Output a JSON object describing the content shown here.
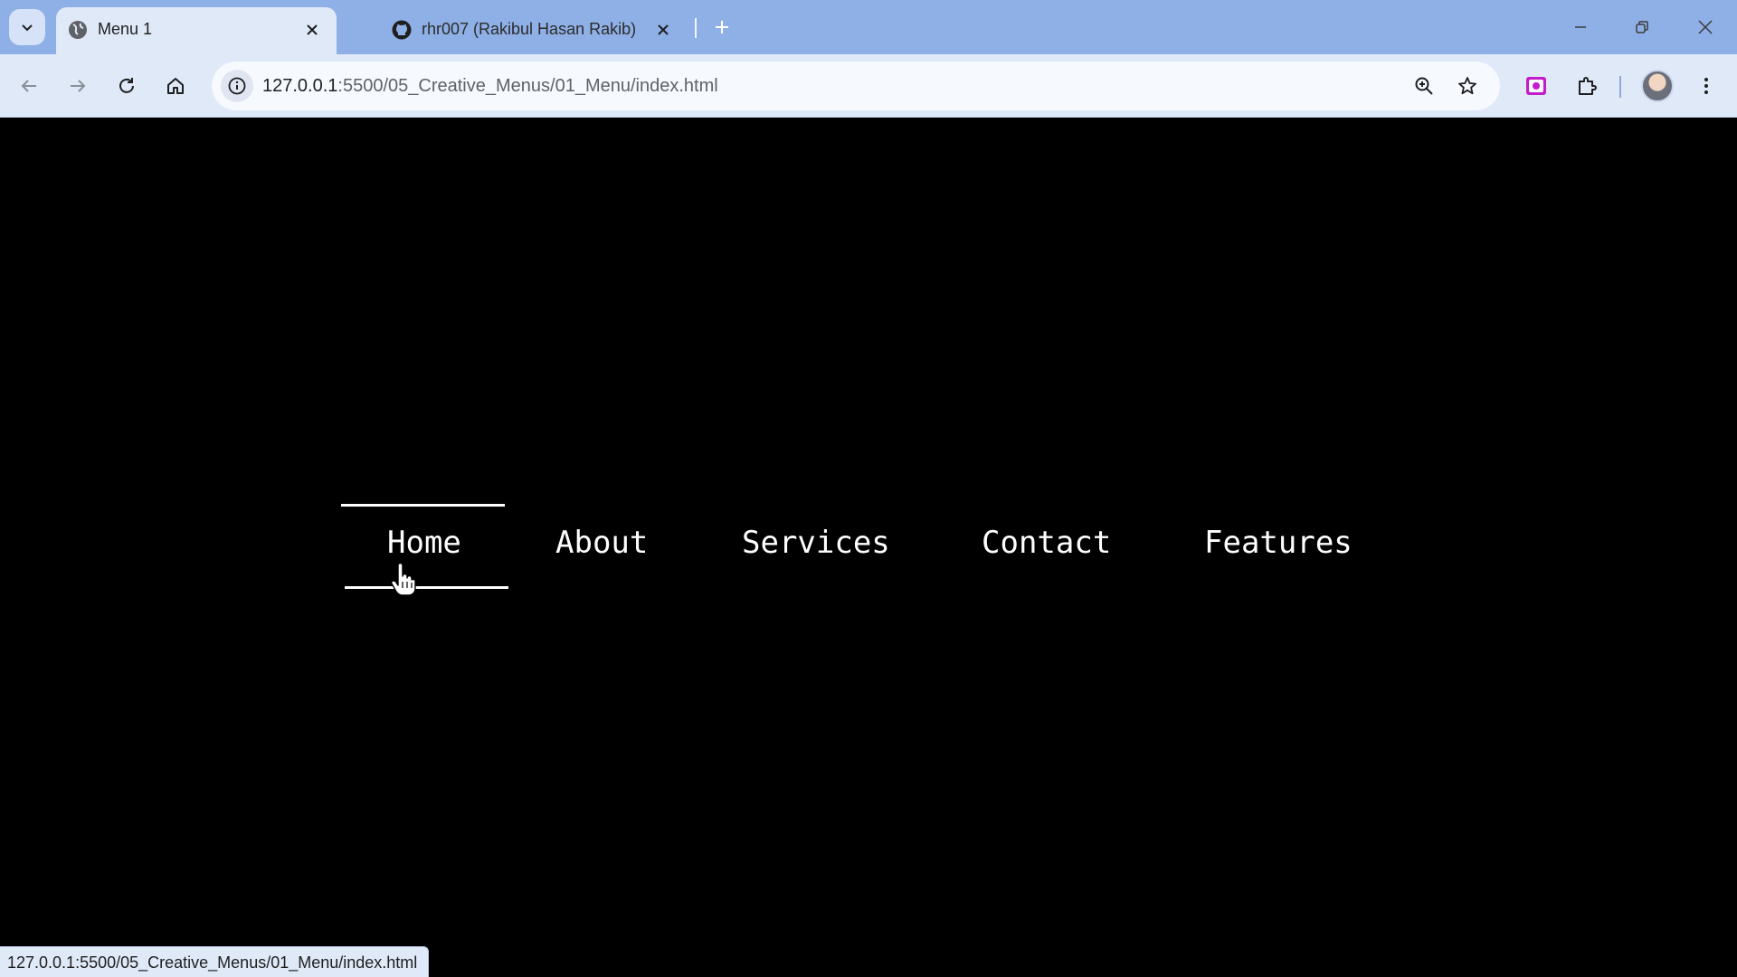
{
  "browser": {
    "tabs": [
      {
        "title": "Menu 1",
        "active": true,
        "icon": "globe-icon"
      },
      {
        "title": "rhr007 (Rakibul Hasan Rakib)",
        "active": false,
        "icon": "github-icon"
      }
    ],
    "address_bar": {
      "host": "127.0.0.1",
      "path": ":5500/05_Creative_Menus/01_Menu/index.html"
    },
    "status_url": "127.0.0.1:5500/05_Creative_Menus/01_Menu/index.html"
  },
  "menu": {
    "items": [
      "Home",
      "About",
      "Services",
      "Contact",
      "Features"
    ],
    "hovered": "Home"
  },
  "colors": {
    "background": "#000000",
    "menu_text": "#ffffff",
    "tabstrip": "#8fb0e6",
    "toolbar": "#dfe9f8"
  }
}
